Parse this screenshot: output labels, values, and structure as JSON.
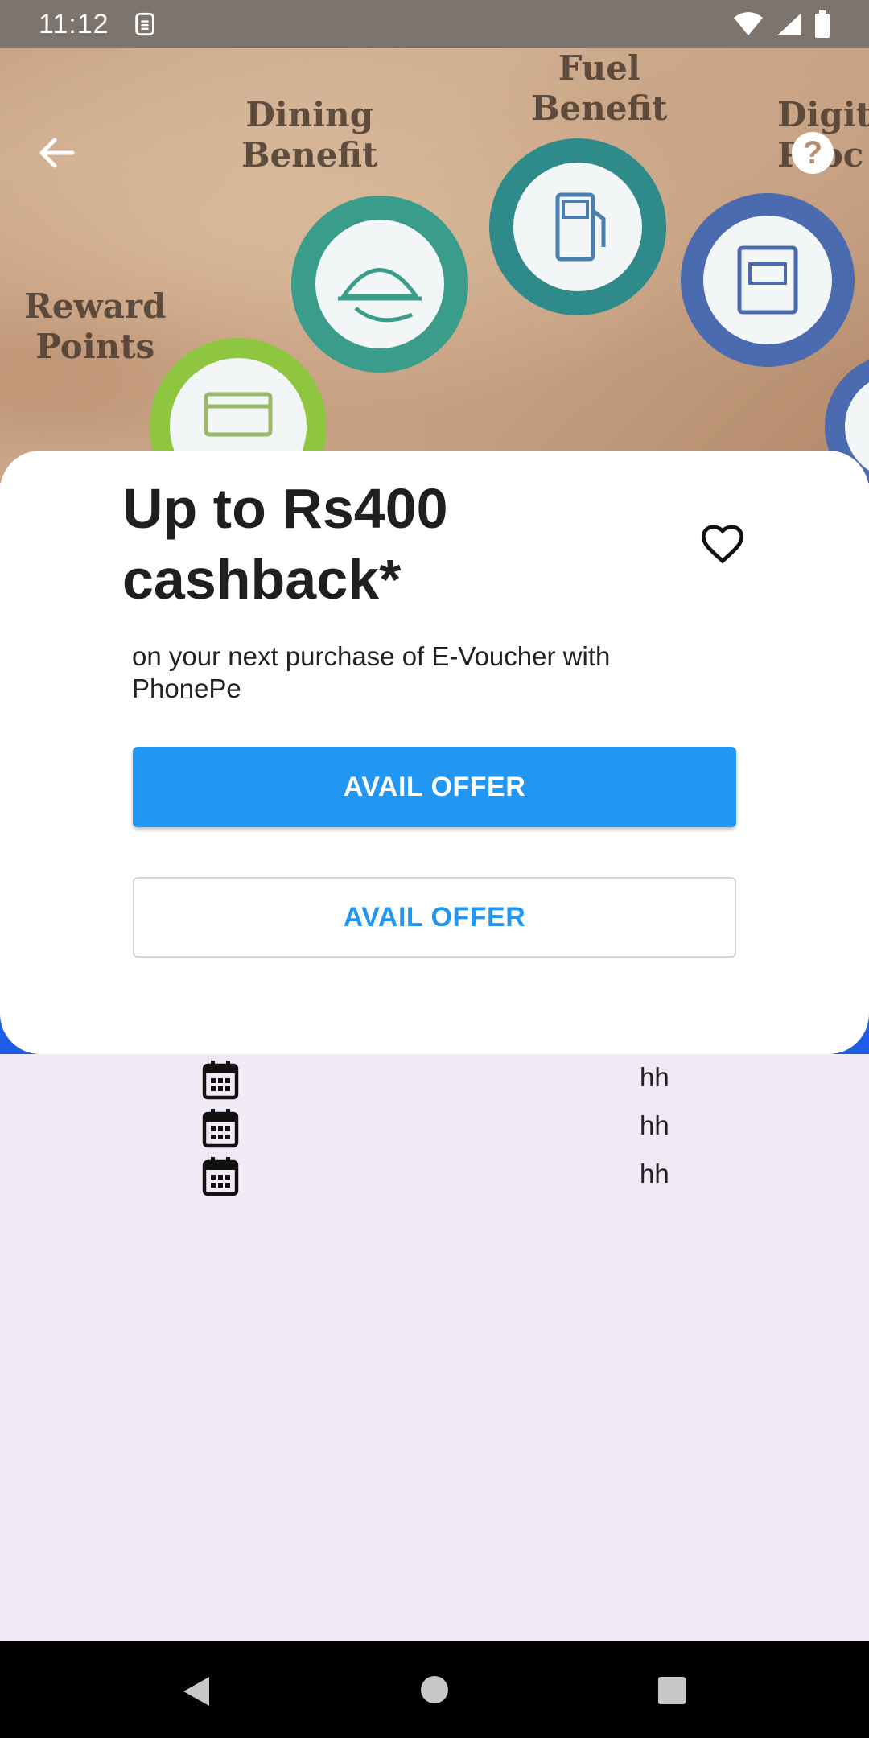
{
  "status_bar": {
    "time": "11:12",
    "icons": [
      "sim-card-icon",
      "wifi-icon",
      "cellular-signal-icon",
      "battery-icon"
    ]
  },
  "hero": {
    "labels": {
      "dining": "Dining\nBenefit",
      "fuel": "Fuel\nBenefit",
      "reward": "Reward\nPoints",
      "digital": "Digit\nProc"
    },
    "colors": {
      "teal": "#3a9d8c",
      "teal_dark": "#2f8b8a",
      "blue": "#4a6bb0",
      "green": "#8fc63f"
    }
  },
  "offer": {
    "title": "Up to Rs400 cashback*",
    "subtitle": "on your next purchase of E-Voucher with PhonePe",
    "primary_button": "AVAIL OFFER",
    "secondary_button": "AVAIL OFFER",
    "accent": "#2196f3"
  },
  "list": {
    "items": [
      {
        "icon": "calendar-icon",
        "value": "hh"
      },
      {
        "icon": "calendar-icon",
        "value": "hh"
      },
      {
        "icon": "calendar-icon",
        "value": "hh"
      }
    ]
  }
}
